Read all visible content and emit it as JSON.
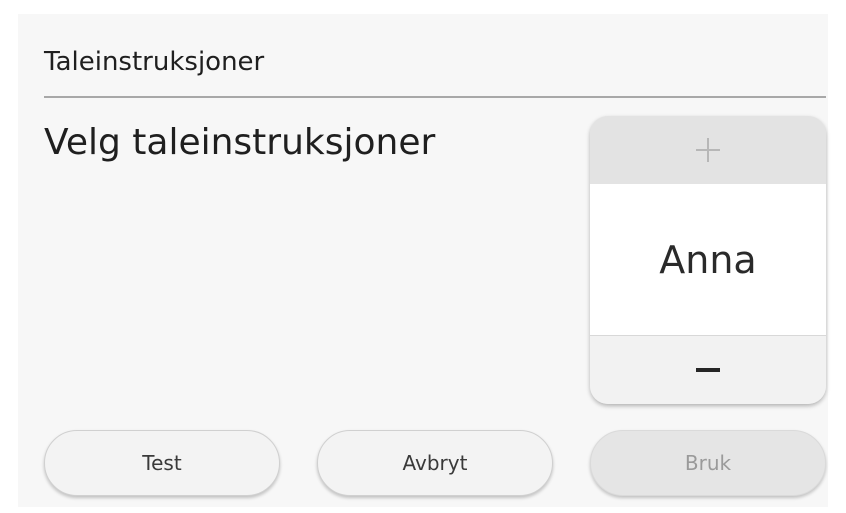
{
  "dialog": {
    "title": "Taleinstruksjoner",
    "prompt": "Velg taleinstruksjoner"
  },
  "picker": {
    "value": "Anna",
    "increment_icon": "plus-icon",
    "decrement_icon": "minus-icon"
  },
  "buttons": {
    "test": "Test",
    "cancel": "Avbryt",
    "apply": "Bruk"
  },
  "colors": {
    "background": "#f7f7f7",
    "divider": "#a8a8a8",
    "disabled_text": "#9a9a9a"
  }
}
